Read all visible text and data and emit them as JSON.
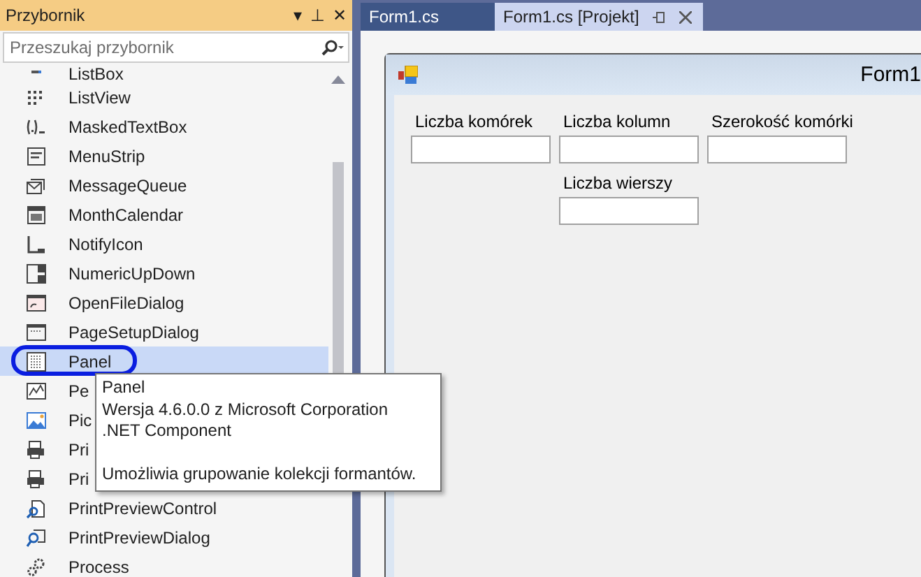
{
  "toolbox": {
    "title": "Przybornik",
    "dropdown_glyph": "▾",
    "pin_glyph": "⊥",
    "close_glyph": "✕",
    "search": {
      "placeholder": "Przeszukaj przybornik"
    },
    "items": [
      {
        "label": "ListBox",
        "selected": false
      },
      {
        "label": "ListView",
        "selected": false
      },
      {
        "label": "MaskedTextBox",
        "selected": false
      },
      {
        "label": "MenuStrip",
        "selected": false
      },
      {
        "label": "MessageQueue",
        "selected": false
      },
      {
        "label": "MonthCalendar",
        "selected": false
      },
      {
        "label": "NotifyIcon",
        "selected": false
      },
      {
        "label": "NumericUpDown",
        "selected": false
      },
      {
        "label": "OpenFileDialog",
        "selected": false
      },
      {
        "label": "PageSetupDialog",
        "selected": false
      },
      {
        "label": "Panel",
        "selected": true
      },
      {
        "label": "Pe",
        "selected": false
      },
      {
        "label": "Pic",
        "selected": false
      },
      {
        "label": "Pri",
        "selected": false
      },
      {
        "label": "Pri",
        "selected": false
      },
      {
        "label": "PrintPreviewControl",
        "selected": false
      },
      {
        "label": "PrintPreviewDialog",
        "selected": false
      },
      {
        "label": "Process",
        "selected": false
      }
    ],
    "tooltip": {
      "title": "Panel",
      "version": "Wersja 4.6.0.0 z Microsoft Corporation",
      "kind": ".NET Component",
      "description": "Umożliwia grupowanie kolekcji formantów."
    }
  },
  "tabs": [
    {
      "label": "Form1.cs",
      "selected": false
    },
    {
      "label": "Form1.cs [Projekt]",
      "selected": true
    }
  ],
  "form": {
    "title": "Form1",
    "fields": [
      {
        "label": "Liczba komórek"
      },
      {
        "label": "Liczba kolumn"
      },
      {
        "label": "Szerokość komórki"
      },
      {
        "label": "Liczba wierszy"
      }
    ]
  }
}
